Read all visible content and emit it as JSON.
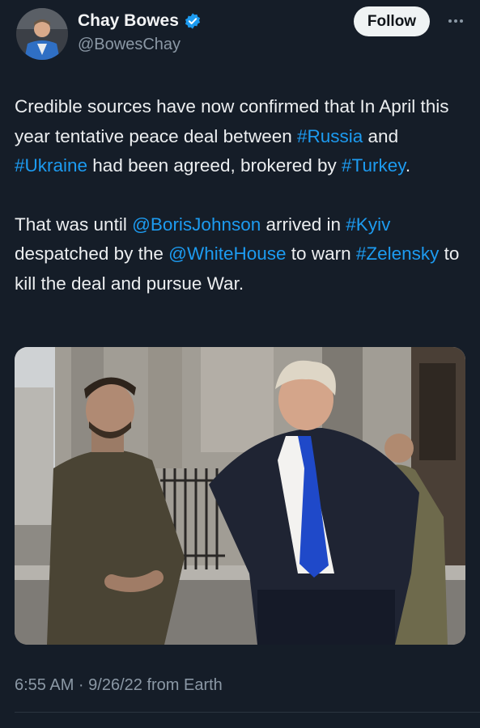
{
  "author": {
    "display_name": "Chay Bowes",
    "handle": "@BowesChay",
    "verified": true
  },
  "actions": {
    "follow_label": "Follow",
    "more_icon": "more-horizontal-icon"
  },
  "tweet": {
    "paragraph1": [
      {
        "text": "Credible sources have now confirmed that In April this year tentative peace deal between ",
        "type": "text"
      },
      {
        "text": "#Russia",
        "type": "hashtag"
      },
      {
        "text": " and ",
        "type": "text"
      },
      {
        "text": "#Ukraine",
        "type": "hashtag"
      },
      {
        "text": " had been agreed, brokered by ",
        "type": "text"
      },
      {
        "text": "#Turkey",
        "type": "hashtag"
      },
      {
        "text": ".",
        "type": "text"
      }
    ],
    "paragraph2": [
      {
        "text": "That was until ",
        "type": "text"
      },
      {
        "text": "@BorisJohnson",
        "type": "mention"
      },
      {
        "text": " arrived in ",
        "type": "text"
      },
      {
        "text": "#Kyiv",
        "type": "hashtag"
      },
      {
        "text": " despatched by the ",
        "type": "text"
      },
      {
        "text": "@WhiteHouse",
        "type": "mention"
      },
      {
        "text": " to warn ",
        "type": "text"
      },
      {
        "text": "#Zelensky",
        "type": "hashtag"
      },
      {
        "text": " to kill the deal and pursue War.",
        "type": "text"
      }
    ]
  },
  "meta": {
    "timestamp": "6:55 AM · 9/26/22 from Earth"
  },
  "colors": {
    "background": "#151d28",
    "link": "#1d9bf0",
    "verified_badge": "#1d9bf0",
    "secondary_text": "#8b98a5"
  }
}
